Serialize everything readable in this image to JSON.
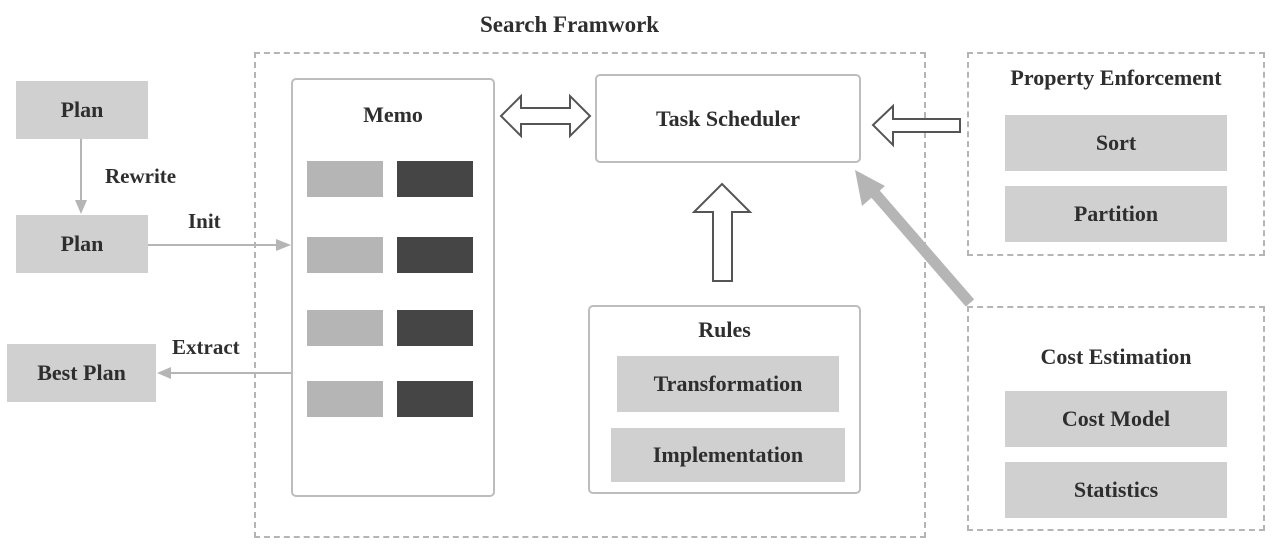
{
  "diagram": {
    "search_framework": {
      "title": "Search Framwork"
    },
    "input_plan": {
      "label": "Plan"
    },
    "rewritten_plan": {
      "label": "Plan"
    },
    "best_plan": {
      "label": "Best Plan"
    },
    "edges": {
      "rewrite": "Rewrite",
      "init": "Init",
      "extract": "Extract"
    },
    "memo": {
      "title": "Memo",
      "group_count": 4
    },
    "task_scheduler": {
      "title": "Task Scheduler"
    },
    "rules": {
      "title": "Rules",
      "items": [
        "Transformation",
        "Implementation"
      ]
    },
    "property_enforcement": {
      "title": "Property Enforcement",
      "items": [
        "Sort",
        "Partition"
      ]
    },
    "cost_estimation": {
      "title": "Cost Estimation",
      "items": [
        "Cost Model",
        "Statistics"
      ]
    },
    "colors": {
      "box_fill": "#d0d0d0",
      "memo_slot_light": "#b5b5b5",
      "memo_slot_dark": "#454545",
      "border": "#b5b5b5",
      "text": "#2e2e2e"
    }
  }
}
